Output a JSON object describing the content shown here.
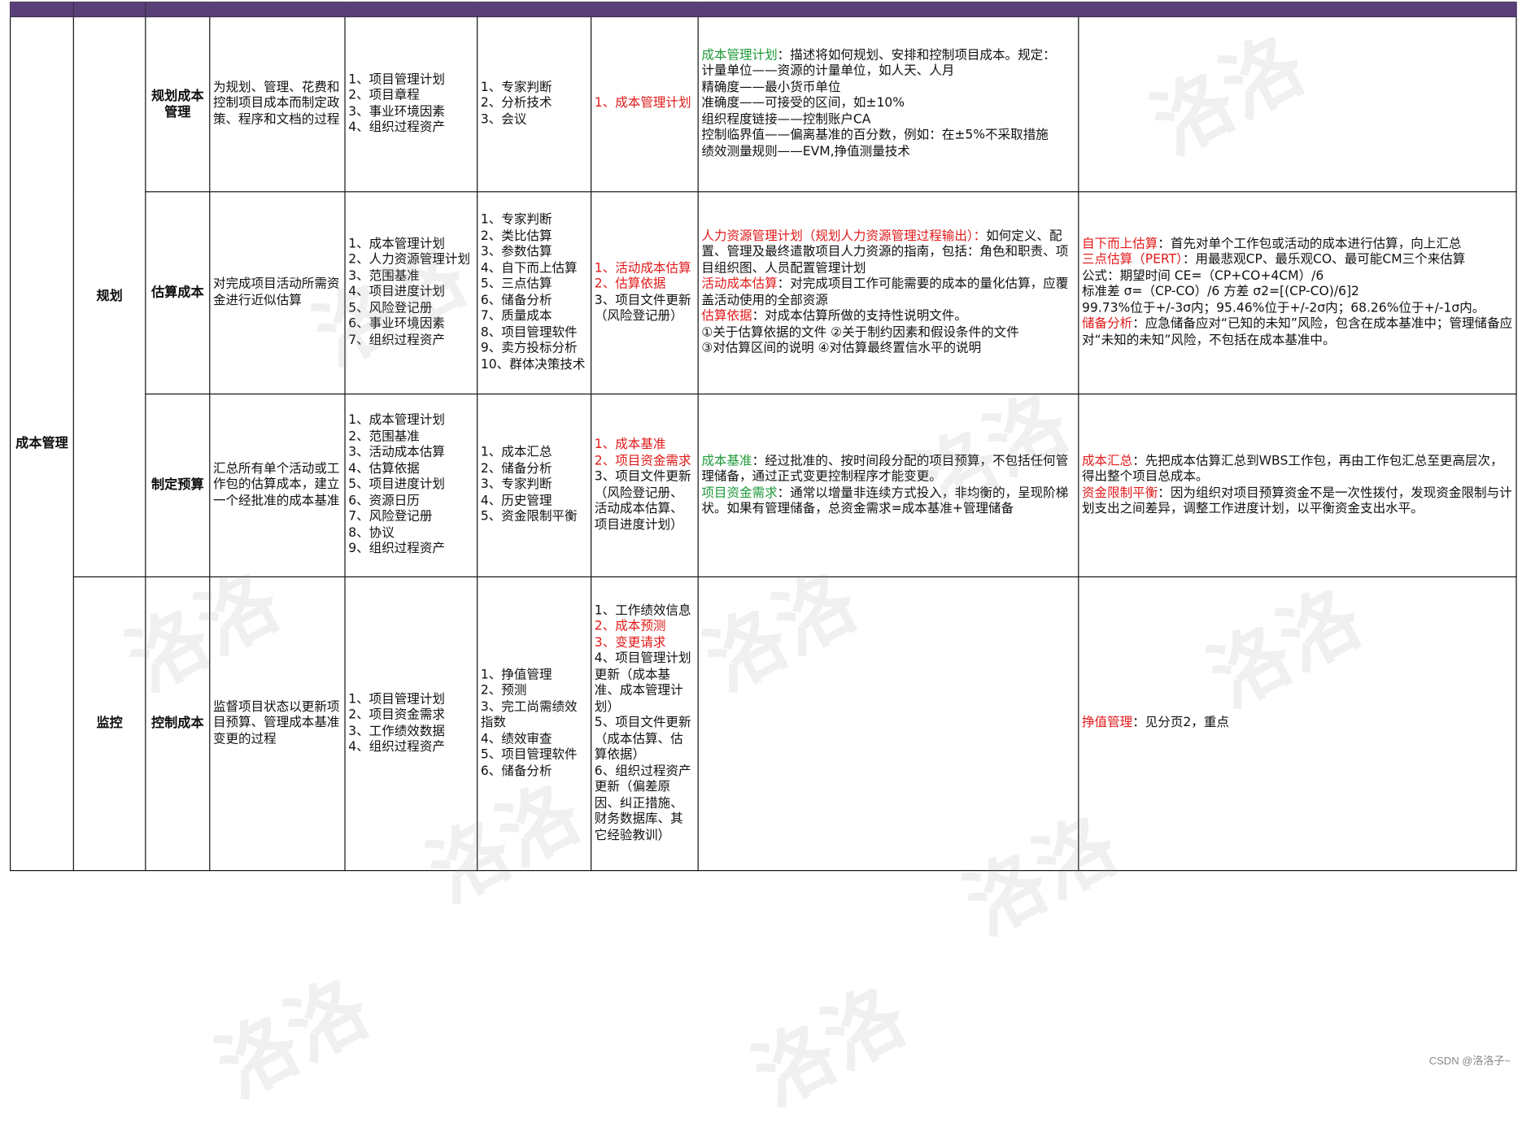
{
  "area": "成本管理",
  "groups": {
    "planning": "规划",
    "monitoring": "监控"
  },
  "rows": [
    {
      "process": "规划成本管理",
      "definition": "为规划、管理、花费和控制项目成本而制定政策、程序和文档的过程",
      "inputs": [
        "1、项目管理计划",
        "2、项目章程",
        "3、事业环境因素",
        "4、组织过程资产"
      ],
      "tools": [
        "1、专家判断",
        "2、分析技术",
        "3、会议"
      ],
      "outputs": [
        {
          "text": "1、成本管理计划",
          "hl": "red"
        }
      ],
      "output_notes": [
        [
          {
            "text": "成本管理计划",
            "hl": "green"
          },
          {
            "text": "：描述将如何规划、安排和控制项目成本。规定：",
            "hl": ""
          }
        ],
        [
          {
            "text": "计量单位——资源的计量单位，如人天、人月",
            "hl": ""
          }
        ],
        [
          {
            "text": "精确度——最小货币单位",
            "hl": ""
          }
        ],
        [
          {
            "text": "准确度——可接受的区间，如±10%",
            "hl": ""
          }
        ],
        [
          {
            "text": "组织程度链接——控制账户CA",
            "hl": ""
          }
        ],
        [
          {
            "text": "控制临界值——偏离基准的百分数，例如：在±5%不采取措施",
            "hl": ""
          }
        ],
        [
          {
            "text": "绩效测量规则——EVM,挣值测量技术",
            "hl": ""
          }
        ]
      ],
      "tool_notes": []
    },
    {
      "process": "估算成本",
      "definition": "对完成项目活动所需资金进行近似估算",
      "inputs": [
        "1、成本管理计划",
        "2、人力资源管理计划",
        "3、范围基准",
        "4、项目进度计划",
        "5、风险登记册",
        "6、事业环境因素",
        "7、组织过程资产"
      ],
      "tools": [
        "1、专家判断",
        "2、类比估算",
        "3、参数估算",
        "4、自下而上估算",
        "5、三点估算",
        "6、储备分析",
        "7、质量成本",
        "8、项目管理软件",
        "9、卖方投标分析",
        "10、群体决策技术"
      ],
      "outputs": [
        {
          "text": "1、活动成本估算",
          "hl": "red"
        },
        {
          "text": "2、估算依据",
          "hl": "red"
        },
        {
          "text": "3、项目文件更新（风险登记册）",
          "hl": ""
        }
      ],
      "output_notes": [
        [
          {
            "text": "人力资源管理计划（规划人力资源管理过程输出）：",
            "hl": "red"
          },
          {
            "text": "如何定义、配置、管理及最终遣散项目人力资源的指南，包括：角色和职责、项目组织图、人员配置管理计划",
            "hl": ""
          }
        ],
        [
          {
            "text": "活动成本估算",
            "hl": "red"
          },
          {
            "text": "：对完成项目工作可能需要的成本的量化估算，应覆盖活动使用的全部资源",
            "hl": ""
          }
        ],
        [
          {
            "text": "估算依据",
            "hl": "red"
          },
          {
            "text": "：对成本估算所做的支持性说明文件。",
            "hl": ""
          }
        ],
        [
          {
            "text": "①关于估算依据的文件 ②关于制约因素和假设条件的文件",
            "hl": ""
          }
        ],
        [
          {
            "text": "③对估算区间的说明 ④对估算最终置信水平的说明",
            "hl": ""
          }
        ]
      ],
      "tool_notes": [
        [
          {
            "text": "自下而上估算",
            "hl": "red"
          },
          {
            "text": "：首先对单个工作包或活动的成本进行估算，向上汇总",
            "hl": ""
          }
        ],
        [
          {
            "text": "三点估算（PERT）",
            "hl": "red"
          },
          {
            "text": "：用最悲观CP、最乐观CO、最可能CM三个来估算",
            "hl": ""
          }
        ],
        [
          {
            "text": "公式：期望时间 CE=（CP+CO+4CM）/6",
            "hl": ""
          }
        ],
        [
          {
            "text": "标准差 σ=（CP-CO）/6 方差 σ2=[(CP-CO)/6]2",
            "hl": ""
          }
        ],
        [
          {
            "text": "99.73%位于+/-3σ内；95.46%位于+/-2σ内；68.26%位于+/-1σ内。",
            "hl": ""
          }
        ],
        [
          {
            "text": "储备分析",
            "hl": "red"
          },
          {
            "text": "：应急储备应对“已知的未知”风险，包含在成本基准中；管理储备应对“未知的未知”风险，不包括在成本基准中。",
            "hl": ""
          }
        ]
      ]
    },
    {
      "process": "制定预算",
      "definition": "汇总所有单个活动或工作包的估算成本，建立一个经批准的成本基准",
      "inputs": [
        "1、成本管理计划",
        "2、范围基准",
        "3、活动成本估算",
        "4、估算依据",
        "5、项目进度计划",
        "6、资源日历",
        "7、风险登记册",
        "8、协议",
        "9、组织过程资产"
      ],
      "tools": [
        "1、成本汇总",
        "2、储备分析",
        "3、专家判断",
        "4、历史管理",
        "5、资金限制平衡"
      ],
      "outputs": [
        {
          "text": "1、成本基准",
          "hl": "red"
        },
        {
          "text": "2、项目资金需求",
          "hl": "red"
        },
        {
          "text": "3、项目文件更新（风险登记册、活动成本估算、项目进度计划）",
          "hl": ""
        }
      ],
      "output_notes": [
        [
          {
            "text": "成本基准",
            "hl": "green"
          },
          {
            "text": "：经过批准的、按时间段分配的项目预算，不包括任何管理储备，通过正式变更控制程序才能变更。",
            "hl": ""
          }
        ],
        [
          {
            "text": "项目资金需求",
            "hl": "green"
          },
          {
            "text": "：通常以增量非连续方式投入，非均衡的，呈现阶梯状。如果有管理储备，总资金需求=成本基准+管理储备",
            "hl": ""
          }
        ]
      ],
      "tool_notes": [
        [
          {
            "text": "成本汇总",
            "hl": "red"
          },
          {
            "text": "：先把成本估算汇总到WBS工作包，再由工作包汇总至更高层次，得出整个项目总成本。",
            "hl": ""
          }
        ],
        [
          {
            "text": "资金限制平衡",
            "hl": "red"
          },
          {
            "text": "：因为组织对项目预算资金不是一次性拨付，发现资金限制与计划支出之间差异，调整工作进度计划，以平衡资金支出水平。",
            "hl": ""
          }
        ]
      ]
    },
    {
      "process": "控制成本",
      "definition": "监督项目状态以更新项目预算、管理成本基准变更的过程",
      "inputs": [
        "1、项目管理计划",
        "2、项目资金需求",
        "3、工作绩效数据",
        "4、组织过程资产"
      ],
      "tools": [
        "1、挣值管理",
        "2、预测",
        "3、完工尚需绩效指数",
        "4、绩效审查",
        "5、项目管理软件",
        "6、储备分析"
      ],
      "outputs": [
        {
          "text": "1、工作绩效信息",
          "hl": ""
        },
        {
          "text": "2、成本预测",
          "hl": "red"
        },
        {
          "text": "3、变更请求",
          "hl": "red"
        },
        {
          "text": "4、项目管理计划更新（成本基准、成本管理计划）",
          "hl": ""
        },
        {
          "text": "5、项目文件更新（成本估算、估算依据）",
          "hl": ""
        },
        {
          "text": "6、组织过程资产更新（偏差原因、纠正措施、财务数据库、其它经验教训）",
          "hl": ""
        }
      ],
      "output_notes": [],
      "tool_notes": [
        [
          {
            "text": "挣值管理",
            "hl": "red"
          },
          {
            "text": "：见分页2，重点",
            "hl": ""
          }
        ]
      ]
    }
  ],
  "watermark": "洛洛",
  "credit": "CSDN @洛洛子~"
}
